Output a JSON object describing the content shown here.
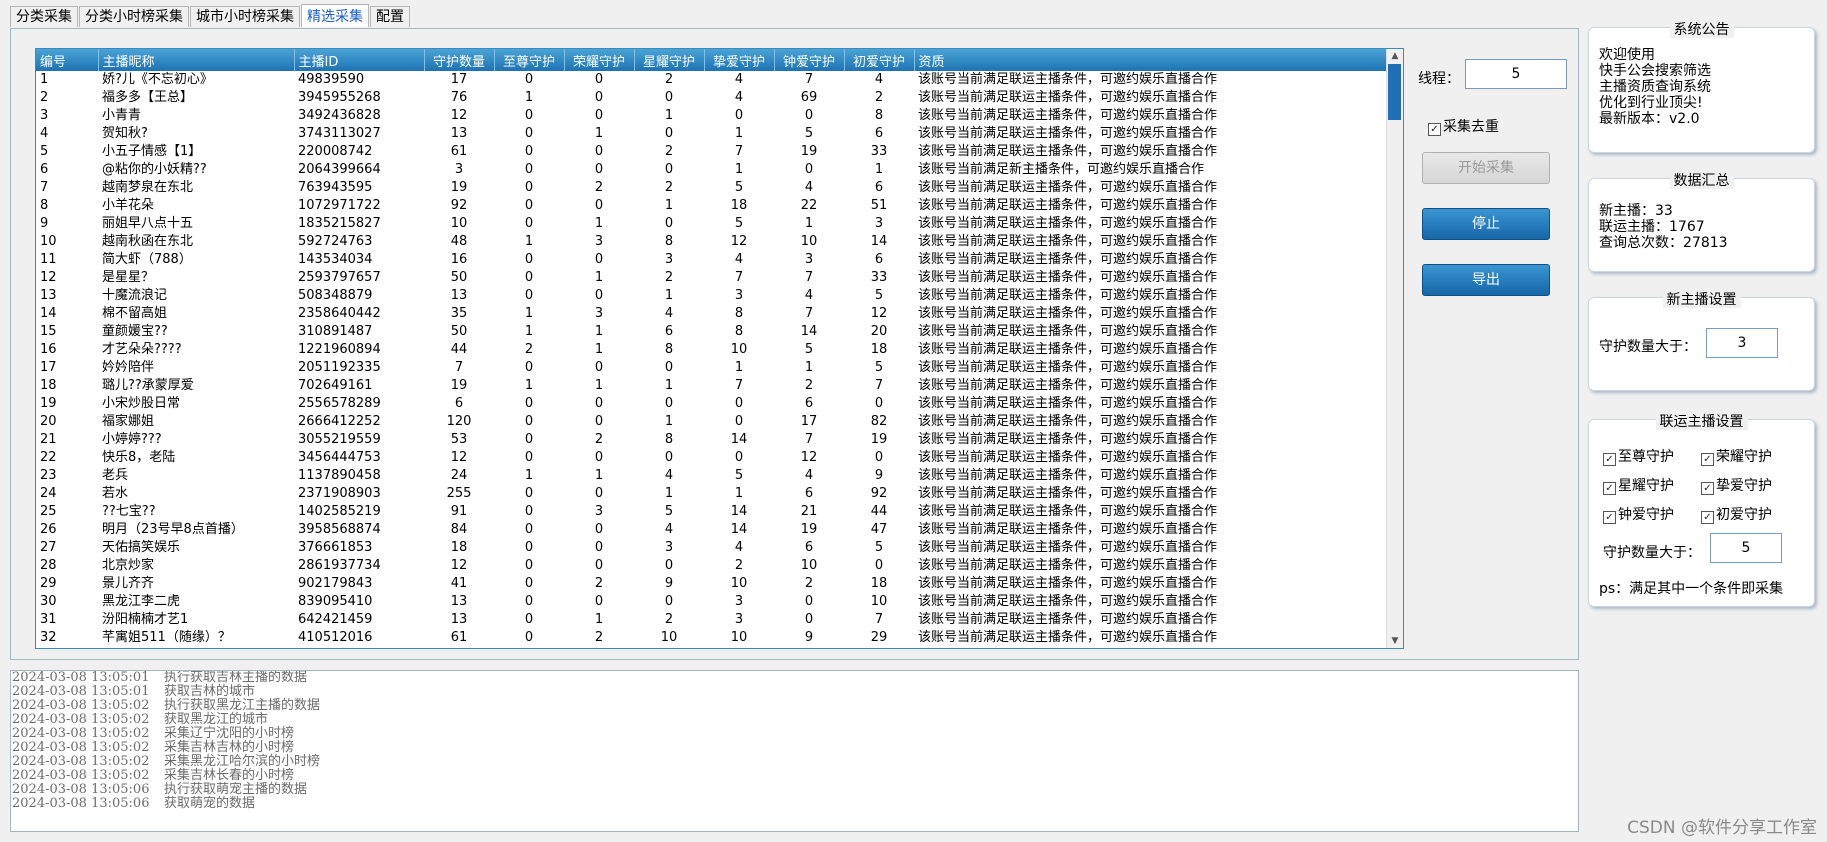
{
  "tabs": [
    "分类采集",
    "分类小时榜采集",
    "城市小时榜采集",
    "精选采集",
    "配置"
  ],
  "active_tab": "精选采集",
  "grid": {
    "columns": [
      "编号",
      "主播昵称",
      "主播ID",
      "守护数量",
      "至尊守护",
      "荣耀守护",
      "星耀守护",
      "挚爱守护",
      "钟爱守护",
      "初爱守护",
      "资质"
    ],
    "rows": [
      [
        "1",
        "娇?儿《不忘初心》",
        "49839590",
        "17",
        "0",
        "0",
        "2",
        "4",
        "7",
        "4",
        "该账号当前满足联运主播条件，可邀约娱乐直播合作"
      ],
      [
        "2",
        "福多多【王总】",
        "3945955268",
        "76",
        "1",
        "0",
        "0",
        "4",
        "69",
        "2",
        "该账号当前满足联运主播条件，可邀约娱乐直播合作"
      ],
      [
        "3",
        "小青青",
        "3492436828",
        "12",
        "0",
        "0",
        "1",
        "0",
        "0",
        "8",
        "该账号当前满足联运主播条件，可邀约娱乐直播合作"
      ],
      [
        "4",
        "贺知秋?",
        "3743113027",
        "13",
        "0",
        "1",
        "0",
        "1",
        "5",
        "6",
        "该账号当前满足联运主播条件，可邀约娱乐直播合作"
      ],
      [
        "5",
        "小五子情感【1】",
        "220008742",
        "61",
        "0",
        "0",
        "2",
        "7",
        "19",
        "33",
        "该账号当前满足联运主播条件，可邀约娱乐直播合作"
      ],
      [
        "6",
        "@粘你的小妖精??",
        "2064399664",
        "3",
        "0",
        "0",
        "0",
        "1",
        "0",
        "1",
        "该账号当前满足新主播条件，可邀约娱乐直播合作"
      ],
      [
        "7",
        "越南梦泉在东北",
        "763943595",
        "19",
        "0",
        "2",
        "2",
        "5",
        "4",
        "6",
        "该账号当前满足联运主播条件，可邀约娱乐直播合作"
      ],
      [
        "8",
        "小羊花朵",
        "1072971722",
        "92",
        "0",
        "0",
        "1",
        "18",
        "22",
        "51",
        "该账号当前满足联运主播条件，可邀约娱乐直播合作"
      ],
      [
        "9",
        "丽姐早八点十五",
        "1835215827",
        "10",
        "0",
        "1",
        "0",
        "5",
        "1",
        "3",
        "该账号当前满足联运主播条件，可邀约娱乐直播合作"
      ],
      [
        "10",
        "越南秋函在东北",
        "592724763",
        "48",
        "1",
        "3",
        "8",
        "12",
        "10",
        "14",
        "该账号当前满足联运主播条件，可邀约娱乐直播合作"
      ],
      [
        "11",
        "简大虾（788）",
        "143534034",
        "16",
        "0",
        "0",
        "3",
        "4",
        "3",
        "6",
        "该账号当前满足联运主播条件，可邀约娱乐直播合作"
      ],
      [
        "12",
        "是星星？",
        "2593797657",
        "50",
        "0",
        "1",
        "2",
        "7",
        "7",
        "33",
        "该账号当前满足联运主播条件，可邀约娱乐直播合作"
      ],
      [
        "13",
        "十魔流浪记",
        "508348879",
        "13",
        "0",
        "0",
        "1",
        "3",
        "4",
        "5",
        "该账号当前满足联运主播条件，可邀约娱乐直播合作"
      ],
      [
        "14",
        "棉不留高姐",
        "2358640442",
        "35",
        "1",
        "3",
        "4",
        "8",
        "7",
        "12",
        "该账号当前满足联运主播条件，可邀约娱乐直播合作"
      ],
      [
        "15",
        "童颜媛宝??",
        "310891487",
        "50",
        "1",
        "1",
        "6",
        "8",
        "14",
        "20",
        "该账号当前满足联运主播条件，可邀约娱乐直播合作"
      ],
      [
        "16",
        "才艺朵朵????",
        "1221960894",
        "44",
        "2",
        "1",
        "8",
        "10",
        "5",
        "18",
        "该账号当前满足联运主播条件，可邀约娱乐直播合作"
      ],
      [
        "17",
        "妗妗陪伴",
        "2051192335",
        "7",
        "0",
        "0",
        "0",
        "1",
        "1",
        "5",
        "该账号当前满足联运主播条件，可邀约娱乐直播合作"
      ],
      [
        "18",
        "璐儿??承蒙厚爱",
        "702649161",
        "19",
        "1",
        "1",
        "1",
        "7",
        "2",
        "7",
        "该账号当前满足联运主播条件，可邀约娱乐直播合作"
      ],
      [
        "19",
        "小宋炒股日常",
        "2556578289",
        "6",
        "0",
        "0",
        "0",
        "0",
        "6",
        "0",
        "该账号当前满足联运主播条件，可邀约娱乐直播合作"
      ],
      [
        "20",
        "福家娜姐",
        "2666412252",
        "120",
        "0",
        "0",
        "1",
        "0",
        "17",
        "82",
        "该账号当前满足联运主播条件，可邀约娱乐直播合作"
      ],
      [
        "21",
        "小婷婷???",
        "3055219559",
        "53",
        "0",
        "2",
        "8",
        "14",
        "7",
        "19",
        "该账号当前满足联运主播条件，可邀约娱乐直播合作"
      ],
      [
        "22",
        "快乐8，老陆",
        "3456444753",
        "12",
        "0",
        "0",
        "0",
        "0",
        "12",
        "0",
        "该账号当前满足联运主播条件，可邀约娱乐直播合作"
      ],
      [
        "23",
        "老兵",
        "1137890458",
        "24",
        "1",
        "1",
        "4",
        "5",
        "4",
        "9",
        "该账号当前满足联运主播条件，可邀约娱乐直播合作"
      ],
      [
        "24",
        "若水",
        "2371908903",
        "255",
        "0",
        "0",
        "1",
        "1",
        "6",
        "92",
        "该账号当前满足联运主播条件，可邀约娱乐直播合作"
      ],
      [
        "25",
        "??七宝??",
        "1402585219",
        "91",
        "0",
        "3",
        "5",
        "14",
        "21",
        "44",
        "该账号当前满足联运主播条件，可邀约娱乐直播合作"
      ],
      [
        "26",
        "明月（23号早8点首播）",
        "3958568874",
        "84",
        "0",
        "0",
        "4",
        "14",
        "19",
        "47",
        "该账号当前满足联运主播条件，可邀约娱乐直播合作"
      ],
      [
        "27",
        "天佑搞笑娱乐",
        "376661853",
        "18",
        "0",
        "0",
        "3",
        "4",
        "6",
        "5",
        "该账号当前满足联运主播条件，可邀约娱乐直播合作"
      ],
      [
        "28",
        "北京炒家",
        "2861937734",
        "12",
        "0",
        "0",
        "0",
        "2",
        "10",
        "0",
        "该账号当前满足联运主播条件，可邀约娱乐直播合作"
      ],
      [
        "29",
        "景儿齐齐",
        "902179843",
        "41",
        "0",
        "2",
        "9",
        "10",
        "2",
        "18",
        "该账号当前满足联运主播条件，可邀约娱乐直播合作"
      ],
      [
        "30",
        "黑龙江李二虎",
        "839095410",
        "13",
        "0",
        "0",
        "0",
        "3",
        "0",
        "10",
        "该账号当前满足联运主播条件，可邀约娱乐直播合作"
      ],
      [
        "31",
        "汾阳楠楠才艺1",
        "642421459",
        "13",
        "0",
        "1",
        "2",
        "3",
        "0",
        "7",
        "该账号当前满足联运主播条件，可邀约娱乐直播合作"
      ],
      [
        "32",
        "芊寓姐511（随缘）？",
        "410512016",
        "61",
        "0",
        "2",
        "10",
        "10",
        "9",
        "29",
        "该账号当前满足联运主播条件，可邀约娱乐直播合作"
      ]
    ]
  },
  "controls": {
    "thread_label": "线程：",
    "thread_value": "5",
    "dedup_label": "采集去重",
    "dedup_checked": true,
    "start_button": "开始采集",
    "stop_button": "停止",
    "export_button": "导出"
  },
  "announcement": {
    "title": "系统公告",
    "lines": [
      "欢迎使用",
      "快手公会搜索筛选",
      "主播资质查询系统",
      "优化到行业顶尖!",
      "最新版本：v2.0"
    ]
  },
  "summary": {
    "title": "数据汇总",
    "lines": [
      "新主播：33",
      "联运主播：1767",
      "查询总次数：27813"
    ]
  },
  "new_anchor": {
    "title": "新主播设置",
    "guard_label": "守护数量大于：",
    "guard_value": "3"
  },
  "joint_anchor": {
    "title": "联运主播设置",
    "options": [
      {
        "label": "至尊守护",
        "checked": true
      },
      {
        "label": "荣耀守护",
        "checked": true
      },
      {
        "label": "星耀守护",
        "checked": true
      },
      {
        "label": "挚爱守护",
        "checked": true
      },
      {
        "label": "钟爱守护",
        "checked": true
      },
      {
        "label": "初爱守护",
        "checked": true
      }
    ],
    "guard_label": "守护数量大于：",
    "guard_value": "5",
    "note": "ps：满足其中一个条件即采集"
  },
  "log": [
    {
      "time": "2024-03-08 13:05:01",
      "msg": "执行获取吉林主播的数据"
    },
    {
      "time": "2024-03-08 13:05:01",
      "msg": "获取吉林的城市"
    },
    {
      "time": "2024-03-08 13:05:02",
      "msg": "执行获取黑龙江主播的数据"
    },
    {
      "time": "2024-03-08 13:05:02",
      "msg": "获取黑龙江的城市"
    },
    {
      "time": "2024-03-08 13:05:02",
      "msg": "采集辽宁沈阳的小时榜"
    },
    {
      "time": "2024-03-08 13:05:02",
      "msg": "采集吉林吉林的小时榜"
    },
    {
      "time": "2024-03-08 13:05:02",
      "msg": "采集黑龙江哈尔滨的小时榜"
    },
    {
      "time": "2024-03-08 13:05:02",
      "msg": "采集吉林长春的小时榜"
    },
    {
      "time": "2024-03-08 13:05:06",
      "msg": "执行获取萌宠主播的数据"
    },
    {
      "time": "2024-03-08 13:05:06",
      "msg": "获取萌宠的数据"
    }
  ],
  "watermark": "CSDN @软件分享工作室"
}
